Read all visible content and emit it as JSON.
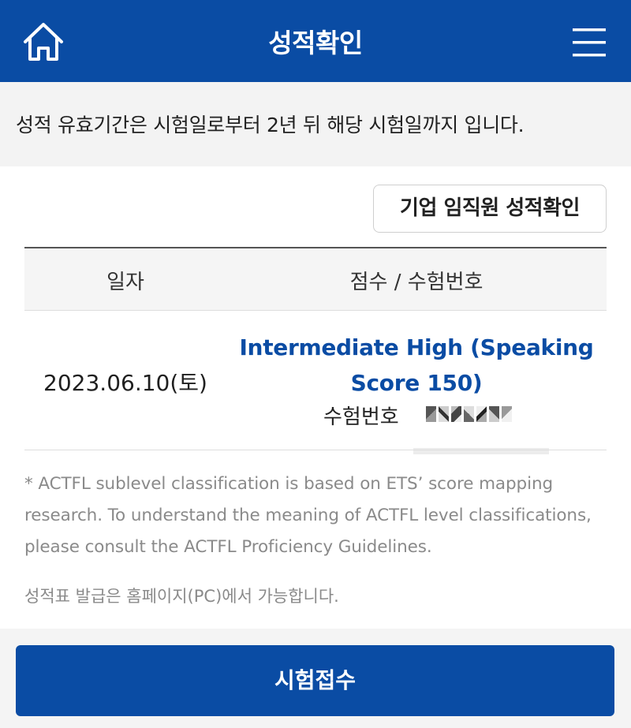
{
  "header": {
    "title": "성적확인",
    "home_icon": "home-icon",
    "menu_icon": "hamburger-menu-icon",
    "background": "#0a4ca4"
  },
  "notice": {
    "text": "성적 유효기간은 시험일로부터 2년 뒤 해당 시험일까지 입니다."
  },
  "corporate_button": {
    "label": "기업 임직원 성적확인"
  },
  "table": {
    "columns": [
      "일자",
      "점수 / 수험번호"
    ],
    "rows": [
      {
        "date": "2023.06.10(토)",
        "score": "Intermediate High (Speaking Score 150)",
        "exam_number_label": "수험번호",
        "exam_number_masked": true
      }
    ]
  },
  "footnote": "* ACTFL sublevel classification is based on ETS’ score mapping research. To understand the meaning of ACTFL level classifications, please consult the ACTFL Proficiency Guidelines.",
  "issue_note": "성적표 발급은 홈페이지(PC)에서 가능합니다.",
  "apply_button": {
    "label": "시험접수"
  },
  "colors": {
    "accent": "#0a4ca4",
    "score_text": "#0a4ca4",
    "muted_text": "#8a8a8a"
  }
}
